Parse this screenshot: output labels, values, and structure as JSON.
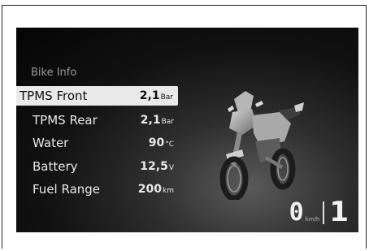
{
  "panel": {
    "title": "Bike Info",
    "items": [
      {
        "label": "TPMS Front",
        "value": "2,1",
        "unit": "Bar",
        "selected": true
      },
      {
        "label": "TPMS Rear",
        "value": "2,1",
        "unit": "Bar",
        "selected": false
      },
      {
        "label": "Water",
        "value": "90",
        "unit": "°C",
        "selected": false
      },
      {
        "label": "Battery",
        "value": "12,5",
        "unit": "V",
        "selected": false
      },
      {
        "label": "Fuel Range",
        "value": "200",
        "unit": "km",
        "selected": false
      }
    ]
  },
  "status": {
    "speed": "0",
    "speed_unit": "km/h",
    "gear": "1"
  },
  "colors": {
    "screen_bg": "#0a0a0a",
    "highlight": "#e9e9e9",
    "text": "#e8e8e8",
    "title_text": "#9a9a9a"
  },
  "icons": {
    "bike": "motorcycle-image"
  }
}
